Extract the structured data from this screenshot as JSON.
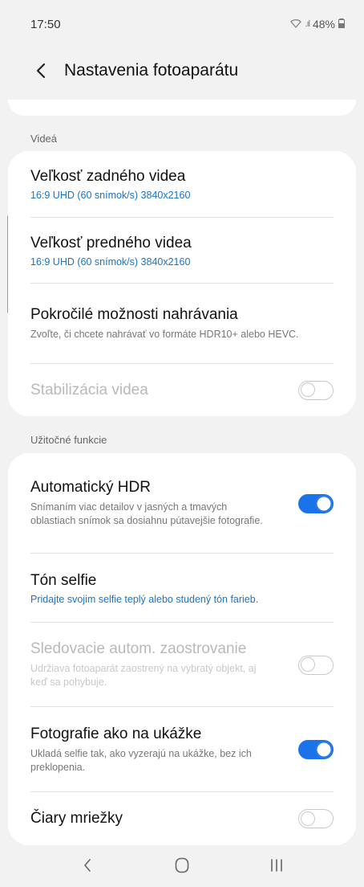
{
  "status": {
    "time": "17:50",
    "battery": "48%"
  },
  "header": {
    "title": "Nastavenia fotoaparátu"
  },
  "sections": {
    "videos": {
      "label": "Videá",
      "rear_video": {
        "title": "Veľkosť zadného videa",
        "value": "16:9 UHD (60 snímok/s) 3840x2160"
      },
      "front_video": {
        "title": "Veľkosť predného videa",
        "value": "16:9 UHD (60 snímok/s) 3840x2160"
      },
      "advanced": {
        "title": "Pokročilé možnosti nahrávania",
        "desc": "Zvoľte, či chcete nahrávať vo formáte HDR10+ alebo HEVC."
      },
      "stabilization": {
        "title": "Stabilizácia videa",
        "enabled": false,
        "on": false
      }
    },
    "useful": {
      "label": "Užitočné funkcie",
      "auto_hdr": {
        "title": "Automatický HDR",
        "desc": "Snímaním viac detailov v jasných a tmavých oblastiach snímok sa dosiahnu pútavejšie fotografie.",
        "on": true
      },
      "selfie_tone": {
        "title": "Tón selfie",
        "value": "Pridajte svojim selfie teplý alebo studený tón farieb."
      },
      "tracking_af": {
        "title": "Sledovacie autom. zaostrovanie",
        "desc": "Udržiava fotoaparát zaostrený na vybratý objekt, aj keď sa pohybuje.",
        "enabled": false,
        "on": false
      },
      "preview_photos": {
        "title": "Fotografie ako na ukážke",
        "desc": "Ukladá selfie tak, ako vyzerajú na ukážke, bez ich preklopenia.",
        "on": true
      },
      "grid_lines": {
        "title": "Čiary mriežky",
        "on": false
      }
    }
  },
  "colors": {
    "accent": "#1a73e8",
    "link": "#1a73c8",
    "background": "#f2f2f2"
  },
  "icons": {
    "back": "chevron-left-icon",
    "nav_back": "chevron-left-icon",
    "nav_home": "home-icon",
    "nav_recents": "recents-icon"
  }
}
